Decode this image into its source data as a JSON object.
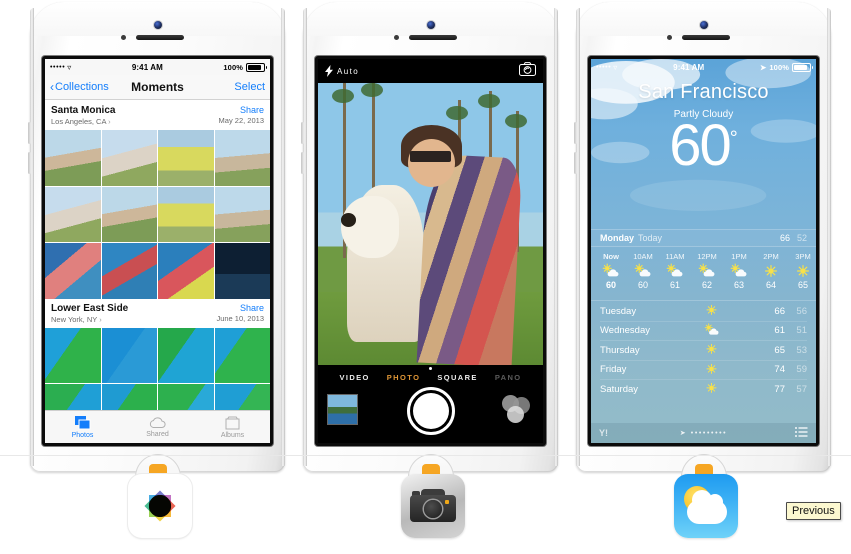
{
  "page": {
    "background": "#ffffff",
    "divider_color": "#e8e8e8"
  },
  "previous_button": {
    "label": "Previous",
    "background": "#fcf8d0",
    "border": "#4a4a4a"
  },
  "phones": [
    {
      "id": "phone-photos",
      "app": "Photos",
      "status_bar": {
        "carrier_dots": "•••••",
        "wifi_icon": "wifi-icon",
        "time": "9:41 AM",
        "battery_text": "100%"
      },
      "nav": {
        "back_label": "Collections",
        "back_icon": "chevron-left-icon",
        "title": "Moments",
        "action_label": "Select"
      },
      "moments": [
        {
          "title": "Santa Monica",
          "location": "Los Angeles, CA",
          "location_chevron": "chevron-right-icon",
          "share_label": "Share",
          "date": "May 22, 2013"
        },
        {
          "title": "Lower East Side",
          "location": "New York, NY",
          "location_chevron": "chevron-right-icon",
          "share_label": "Share",
          "date": "June 10, 2013"
        }
      ],
      "tabbar": [
        {
          "label": "Photos",
          "icon": "photos-stack-icon",
          "selected": true
        },
        {
          "label": "Shared",
          "icon": "cloud-icon",
          "selected": false
        },
        {
          "label": "Albums",
          "icon": "album-box-icon",
          "selected": false
        }
      ],
      "accent_color": "#147efb"
    },
    {
      "id": "phone-camera",
      "app": "Camera",
      "top_bar": {
        "flash_icon": "flash-bolt-icon",
        "flash_label": "Auto",
        "swap_icon": "camera-swap-icon"
      },
      "modes": [
        {
          "label": "VIDEO",
          "selected": false
        },
        {
          "label": "PHOTO",
          "selected": true
        },
        {
          "label": "SQUARE",
          "selected": false
        },
        {
          "label": "PANO",
          "selected": false
        }
      ],
      "selected_mode_color": "#f2a33c",
      "controls": {
        "shutter_icon": "shutter-button",
        "thumbnail_icon": "last-photo-thumbnail",
        "filters_icon": "filters-circles-icon"
      }
    },
    {
      "id": "phone-weather",
      "app": "Weather",
      "status_bar": {
        "carrier_dots": "•••••",
        "wifi_icon": "wifi-icon",
        "time": "9:41 AM",
        "location_icon": "location-arrow-icon",
        "battery_text": "100%"
      },
      "city": "San Francisco",
      "condition": "Partly Cloudy",
      "current_temp": "60",
      "degree_symbol": "°",
      "today": {
        "day": "Monday",
        "label": "Today",
        "high": "66",
        "low": "52"
      },
      "hourly": [
        {
          "time": "Now",
          "icon": "sun-behind-cloud-icon",
          "temp": "60",
          "now": true
        },
        {
          "time": "10AM",
          "icon": "sun-behind-cloud-icon",
          "temp": "60",
          "now": false
        },
        {
          "time": "11AM",
          "icon": "sun-behind-cloud-icon",
          "temp": "61",
          "now": false
        },
        {
          "time": "12PM",
          "icon": "sun-behind-cloud-icon",
          "temp": "62",
          "now": false
        },
        {
          "time": "1PM",
          "icon": "sun-behind-cloud-icon",
          "temp": "63",
          "now": false
        },
        {
          "time": "2PM",
          "icon": "sun-icon",
          "temp": "64",
          "now": false
        },
        {
          "time": "3PM",
          "icon": "sun-icon",
          "temp": "65",
          "now": false
        }
      ],
      "daily": [
        {
          "day": "Tuesday",
          "icon": "sun-icon",
          "high": "66",
          "low": "56"
        },
        {
          "day": "Wednesday",
          "icon": "sun-behind-cloud-icon",
          "high": "61",
          "low": "51"
        },
        {
          "day": "Thursday",
          "icon": "sun-icon",
          "high": "65",
          "low": "53"
        },
        {
          "day": "Friday",
          "icon": "sun-icon",
          "high": "74",
          "low": "59"
        },
        {
          "day": "Saturday",
          "icon": "sun-icon",
          "high": "77",
          "low": "57"
        }
      ],
      "bottom_bar": {
        "provider_icon": "yahoo-icon",
        "provider_label": "Y!",
        "page_dots": "•••••••••",
        "list_icon": "list-icon"
      }
    }
  ],
  "app_icons": [
    {
      "name": "Photos",
      "icon": "photos-app-icon"
    },
    {
      "name": "Camera",
      "icon": "camera-app-icon"
    },
    {
      "name": "Weather",
      "icon": "weather-app-icon"
    }
  ]
}
